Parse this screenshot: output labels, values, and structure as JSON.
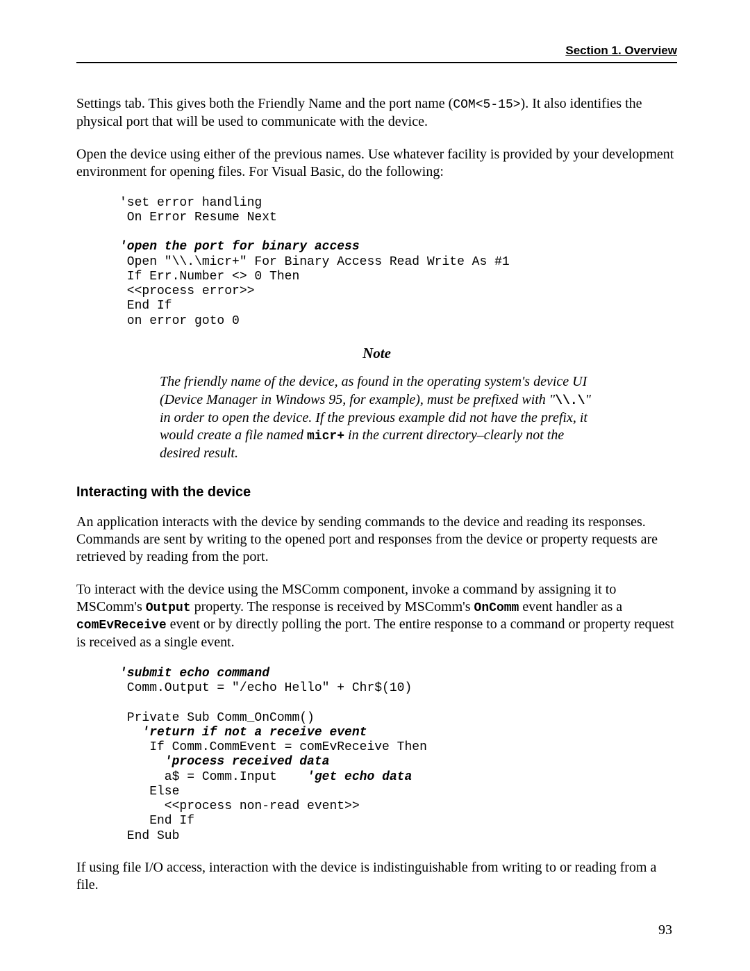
{
  "header": {
    "section": "Section 1.  Overview"
  },
  "para1": {
    "a": "Settings tab.  This gives both the Friendly Name and the port name (",
    "code": "COM<5-15>",
    "b": ").  It also identifies the physical port that will be used to communicate with the device."
  },
  "para2": "Open the device using either of the previous names.  Use whatever facility is provided by your development environment for opening files.  For Visual Basic, do the following:",
  "code1": {
    "l1": "'set error handling",
    "l2": " On Error Resume Next",
    "blank1": "",
    "c1": "'open the port for binary access",
    "l3": " Open \"\\\\.\\micr+\" For Binary Access Read Write As #1",
    "l4": " If Err.Number <> 0 Then",
    "l5": " <<process error>>",
    "l6": " End If",
    "l7": " on error goto 0"
  },
  "note": {
    "title": "Note",
    "a": "The friendly name of the device, as found in the operating system's device UI (Device Manager in Windows 95, for example), must be prefixed with \"",
    "code1": "\\\\.\\",
    "b": "\" in order to open the device.  If the previous example did not have the prefix, it would create a file named ",
    "code2": "micr+",
    "c": " in the current directory–clearly not the desired result."
  },
  "subheading": "Interacting with the device",
  "para3": "An application interacts with the device by sending commands to the device and reading its responses.  Commands are sent by writing to the opened port and responses from the device or property requests are retrieved by reading from the port.",
  "para4": {
    "a": "To interact with the device using the MSComm component, invoke a command by assigning it to MSComm's ",
    "code1": "Output",
    "b": " property.  The response is received by MSComm's ",
    "code2": "OnComm",
    "c": " event handler as a ",
    "code3": "comEvReceive",
    "d": " event or by directly polling the port.  The entire response to a command or property request is received as a single event."
  },
  "code2": {
    "c1": "'submit echo command",
    "l1": " Comm.Output = \"/echo Hello\" + Chr$(10)",
    "blank1": "",
    "l2": " Private Sub Comm_OnComm()",
    "c2": "   'return if not a receive event",
    "l3": "    If Comm.CommEvent = comEvReceive Then",
    "c3": "      'process received data",
    "l4a": "      a$ = Comm.Input    ",
    "c4": "'get echo data",
    "l5": "    Else",
    "l6": "      <<process non-read event>>",
    "l7": "    End If",
    "l8": " End Sub"
  },
  "para5": "If using file I/O access, interaction with the device is indistinguishable from writing to or reading from a file.",
  "pagenum": "93"
}
